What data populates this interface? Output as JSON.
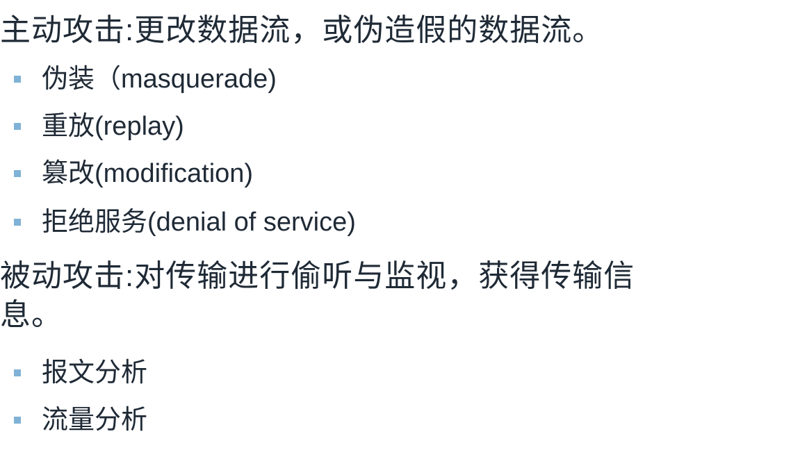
{
  "sections": [
    {
      "heading": "主动攻击:更改数据流，或伪造假的数据流。",
      "items": [
        "伪装（masquerade)",
        "重放(replay)",
        "篡改(modification)",
        "拒绝服务(denial of service)"
      ]
    },
    {
      "heading_line1": "被动攻击:对传输进行偷听与监视，获得传输信",
      "heading_line2": "息。",
      "items": [
        "报文分析",
        "流量分析"
      ]
    }
  ],
  "colors": {
    "text": "#1f2a36",
    "bullet": "#7fb2d6"
  }
}
